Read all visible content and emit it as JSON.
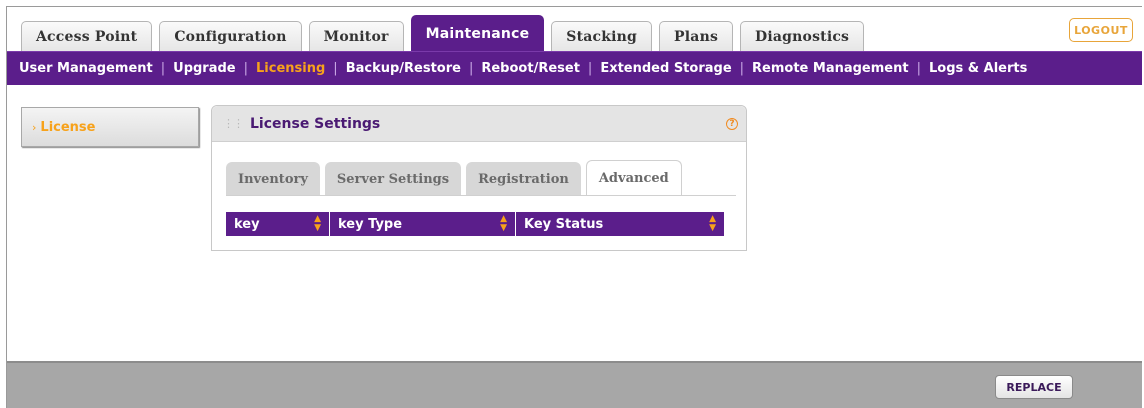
{
  "top_tabs": [
    {
      "label": "Access Point",
      "active": false
    },
    {
      "label": "Configuration",
      "active": false
    },
    {
      "label": "Monitor",
      "active": false
    },
    {
      "label": "Maintenance",
      "active": true
    },
    {
      "label": "Stacking",
      "active": false
    },
    {
      "label": "Plans",
      "active": false
    },
    {
      "label": "Diagnostics",
      "active": false
    }
  ],
  "logout_label": "LOGOUT",
  "subnav": [
    {
      "label": "User Management",
      "active": false
    },
    {
      "label": "Upgrade",
      "active": false
    },
    {
      "label": "Licensing",
      "active": true
    },
    {
      "label": "Backup/Restore",
      "active": false
    },
    {
      "label": "Reboot/Reset",
      "active": false
    },
    {
      "label": "Extended Storage",
      "active": false
    },
    {
      "label": "Remote Management",
      "active": false
    },
    {
      "label": "Logs & Alerts",
      "active": false
    }
  ],
  "sidebar": {
    "items": [
      {
        "label": "License",
        "active": true
      }
    ]
  },
  "panel": {
    "title": "License Settings",
    "help_icon": "?",
    "tabs": [
      {
        "label": "Inventory",
        "active": false
      },
      {
        "label": "Server Settings",
        "active": false
      },
      {
        "label": "Registration",
        "active": false
      },
      {
        "label": "Advanced",
        "active": true
      }
    ],
    "table": {
      "columns": [
        "key",
        "key Type",
        "Key Status"
      ],
      "rows": []
    }
  },
  "footer": {
    "replace_label": "REPLACE"
  },
  "colors": {
    "brand_purple": "#5b1e8b",
    "accent_orange": "#f7a21b",
    "footer_gray": "#a7a7a7"
  },
  "icons": {
    "grip": "drag-handle-icon",
    "help": "help-circle-icon",
    "sort": "sort-arrows-icon",
    "sidebar_arrow": "chevron-right-icon"
  }
}
